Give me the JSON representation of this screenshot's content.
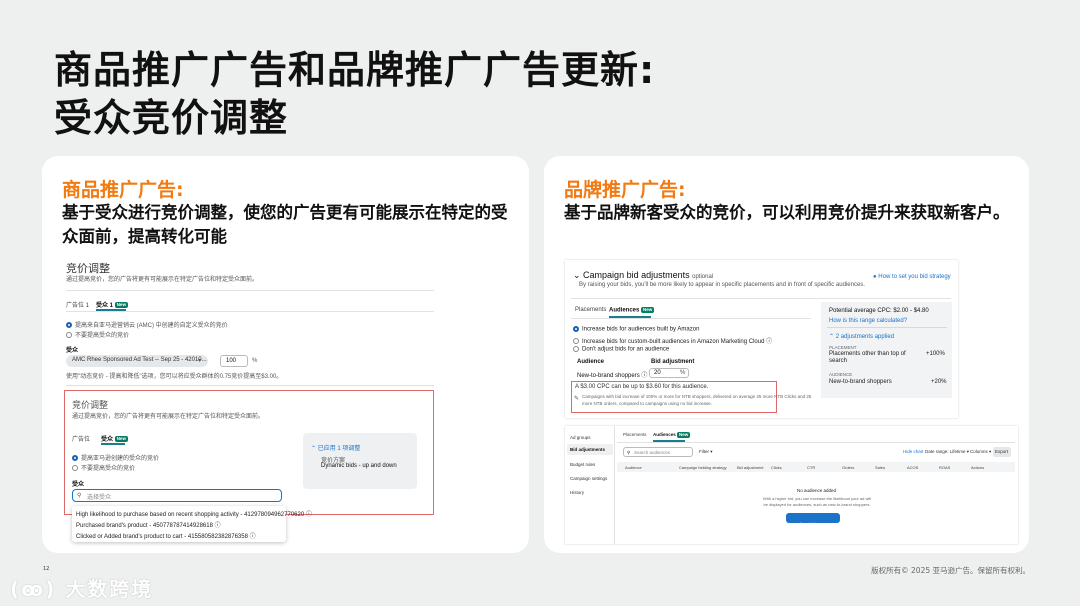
{
  "slide": {
    "title_line1": "商品推广广告和品牌推广广告更新:",
    "title_line2": "受众竞价调整",
    "page_number": "12",
    "copyright": "版权所有© 2025 亚马逊广告。保留所有权利。",
    "logo_text": "大数跨境"
  },
  "left_card": {
    "heading": "商品推广广告:",
    "description": "基于受众进行竞价调整，使您的广告更有可能展示在特定的受众面前，提高转化可能",
    "screenshot": {
      "title": "竞价调整",
      "subtitle": "通过提高竞价，您的广告将更有可能展示在特定广告位和特定受众面前。",
      "tab_placement": "广告位 1",
      "tab_audience": "受众 1",
      "new_badge": "New",
      "radio_amc": "提高来自亚马逊营销云 (AMC) 中创建的自定义受众的竞价",
      "radio_no": "不要提高受众的竞价",
      "audience_label": "受众",
      "audience_select": "AMC Rhee Sponsored Ad Test -- Sep 25 - 42010...",
      "percent_value": "100",
      "percent_sign": "%",
      "hint": "使用\"动态竞价 - 提高和降低\"选项，您可以将应受众群体的0.75竞价提高至$3.00。",
      "inner_title": "竞价调整",
      "inner_subtitle": "通过提高竞价，您的广告将更有可能展示在特定广告位和特定受众面前。",
      "inner_tab_placement": "广告位",
      "inner_tab_audience": "受众",
      "inner_radio_yes": "提高亚马逊创建的受众的竞价",
      "inner_radio_no": "不要提高受众的竞价",
      "inner_audience_label": "受众",
      "search_placeholder": "选择受众",
      "applied_label": "已应用 1 项调整",
      "strategy_label": "竞价方案",
      "strategy_value": "Dynamic bids - up and down",
      "options": [
        "High likelihood to purchase based on recent shopping activity - 412978094962770620",
        "Purchased brand's product - 450778787414928618",
        "Clicked or Added brand's product to cart - 415580582382876358"
      ]
    }
  },
  "right_card": {
    "heading": "品牌推广广告:",
    "description": "基于品牌新客受众的竞价，可以利用竞价提升来获取新客户。",
    "screenshot": {
      "title": "Campaign bid adjustments",
      "optional": "optional",
      "help_link": "How to set you bid strategy",
      "subtitle": "By raising your bids, you'll be more likely to appear in specific placements and in front of specific audiences.",
      "tab_placements": "Placements",
      "tab_audiences": "Audiences",
      "new_badge": "New",
      "radio_amazon": "Increase bids for audiences built by Amazon",
      "radio_custom": "Increase bids for custom-built audiences in Amazon Marketing Cloud",
      "radio_none": "Don't adjust bids for an audience",
      "col_audience": "Audience",
      "col_bid_adjustment": "Bid adjustment",
      "row_audience": "New-to-brand shoppers",
      "row_value": "20",
      "row_percent": "%",
      "cpc_note": "A $3.00 CPC can be up to $3.60 for this audience.",
      "tip": "Campaigns with bid increase of 100% or more for NTB shoppers, delivered on average 25 more NTB Clicks and 25 more NTB orders, compared to campaigns using no bid increase.",
      "potential_cpc": "Potential average CPC: $2.00 - $4.80",
      "range_link": "How is this range calculated?",
      "adjustments_applied": "2 adjustments applied",
      "placement_label": "PLACEMENT",
      "placement_name": "Placements other than top of search",
      "placement_value": "+100%",
      "audience_label": "AUDIENCE",
      "audience_name": "New-to-brand shoppers",
      "audience_value": "+20%",
      "side_nav": [
        "Ad groups",
        "Bid adjustments",
        "Budget rules",
        "Campaign settings",
        "History"
      ],
      "tab2_placements": "Placements",
      "tab2_audiences": "Audiences",
      "search_placeholder": "Search audiences",
      "filter_label": "Filter",
      "hide_chart": "Hide chart",
      "date_range": "Date range: Lifetime",
      "columns": "Columns",
      "export": "Export",
      "table_headers": [
        "Audience",
        "Campaign bidding strategy",
        "Bid adjustment",
        "Clicks",
        "CTR",
        "Orders",
        "Sales",
        "ACOS",
        "ROAS",
        "Actions"
      ],
      "empty_title": "No audience added",
      "empty_text": "With a higher bid, you can increase the likelihood your ad will be displayed for audiences, such as new-to-brand shoppers.",
      "empty_button": "Adjust bids on an audience"
    }
  }
}
